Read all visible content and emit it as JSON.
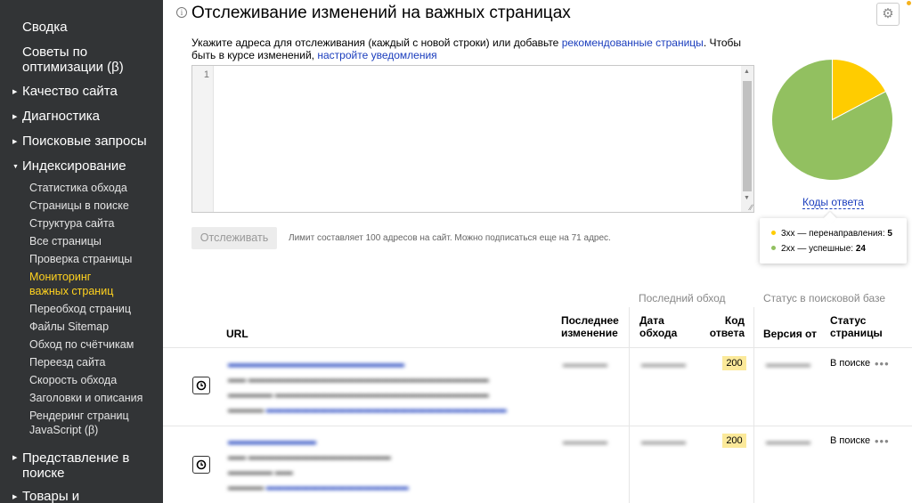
{
  "sidebar": {
    "top_items": [
      "Сводка",
      "Советы по оптимизации (β)"
    ],
    "sections": [
      {
        "label": "Качество сайта"
      },
      {
        "label": "Диагностика"
      },
      {
        "label": "Поисковые запросы"
      },
      {
        "label": "Индексирование"
      }
    ],
    "sub_items": [
      "Статистика обхода",
      "Страницы в поиске",
      "Структура сайта",
      "Все страницы",
      "Проверка страницы",
      "Мониторинг важных страниц",
      "Переобход страниц",
      "Файлы Sitemap",
      "Обход по счётчикам",
      "Переезд сайта",
      "Скорость обхода",
      "Заголовки и описания",
      "Рендеринг страниц JavaScript (β)"
    ],
    "sections_bottom": [
      "Представление в поиске",
      "Товары и"
    ]
  },
  "header": {
    "title": "Отслеживание изменений на важных страницах"
  },
  "description": {
    "text1": "Укажите адреса для отслеживания (каждый с новой строки) или добавьте ",
    "link1": "рекомендованные страницы",
    "text2": ". Чтобы быть в курсе изменений, ",
    "link2": "настройте уведомления"
  },
  "editor": {
    "line_number": "1"
  },
  "track_button": "Отслеживать",
  "limit_text": "Лимит составляет 100 адресов на сайт. Можно подписаться еще на 71 адрес.",
  "pie": {
    "link": "Коды ответа",
    "slices": [
      {
        "label": "3xx — перенаправления:",
        "value": 5,
        "color": "#ffcc00"
      },
      {
        "label": "2xx — успешные:",
        "value": 24,
        "color": "#92c060"
      }
    ]
  },
  "table": {
    "group_last_crawl": "Последний обход",
    "group_status": "Статус в поисковой базе",
    "headers": {
      "url": "URL",
      "last_change": "Последнее изменение",
      "crawl_date": "Дата обхода",
      "response_code": "Код ответа",
      "version_from": "Версия от",
      "page_status": "Статус страницы"
    },
    "rows": [
      {
        "code": "200",
        "status": "В поиске",
        "more": "•••"
      },
      {
        "code": "200",
        "status": "В поиске",
        "more": "•••"
      }
    ]
  }
}
